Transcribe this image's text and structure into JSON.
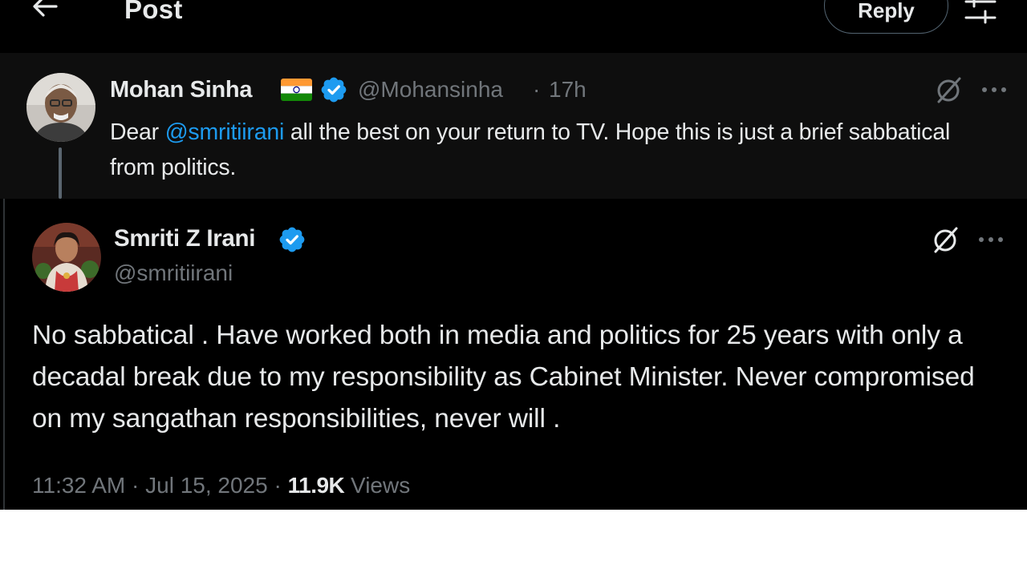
{
  "header": {
    "title": "Post",
    "back_icon": "arrow-left-icon",
    "reply_label": "Reply",
    "filter_icon": "sliders-icon"
  },
  "parent_tweet": {
    "author_name": "Mohan Sinha",
    "flag_icon": "india-flag-icon",
    "verified": true,
    "handle": "@Mohansinha",
    "separator": "·",
    "time": "17h",
    "text_prefix": "Dear ",
    "mention": "@smritiirani",
    "text_suffix": " all the best on your return to TV. Hope this is just a brief sabbatical from politics."
  },
  "main_tweet": {
    "author_name": "Smriti Z Irani",
    "verified": true,
    "handle": "@smritiirani",
    "text": "No sabbatical . Have worked both in media and politics for 25 years with only a decadal break due to my responsibility as Cabinet Minister. Never compromised on my sangathan responsibilities, never will .",
    "time": "11:32 AM",
    "separator1": " · ",
    "date": "Jul 15, 2025",
    "separator2": " · ",
    "views_count": "11.9K",
    "views_label": " Views"
  },
  "colors": {
    "background": "#000000",
    "parent_background": "#0e0e0e",
    "text": "#e7e9ea",
    "muted": "#71767b",
    "accent": "#1d9bf0",
    "verified": "#1d9bf0"
  }
}
